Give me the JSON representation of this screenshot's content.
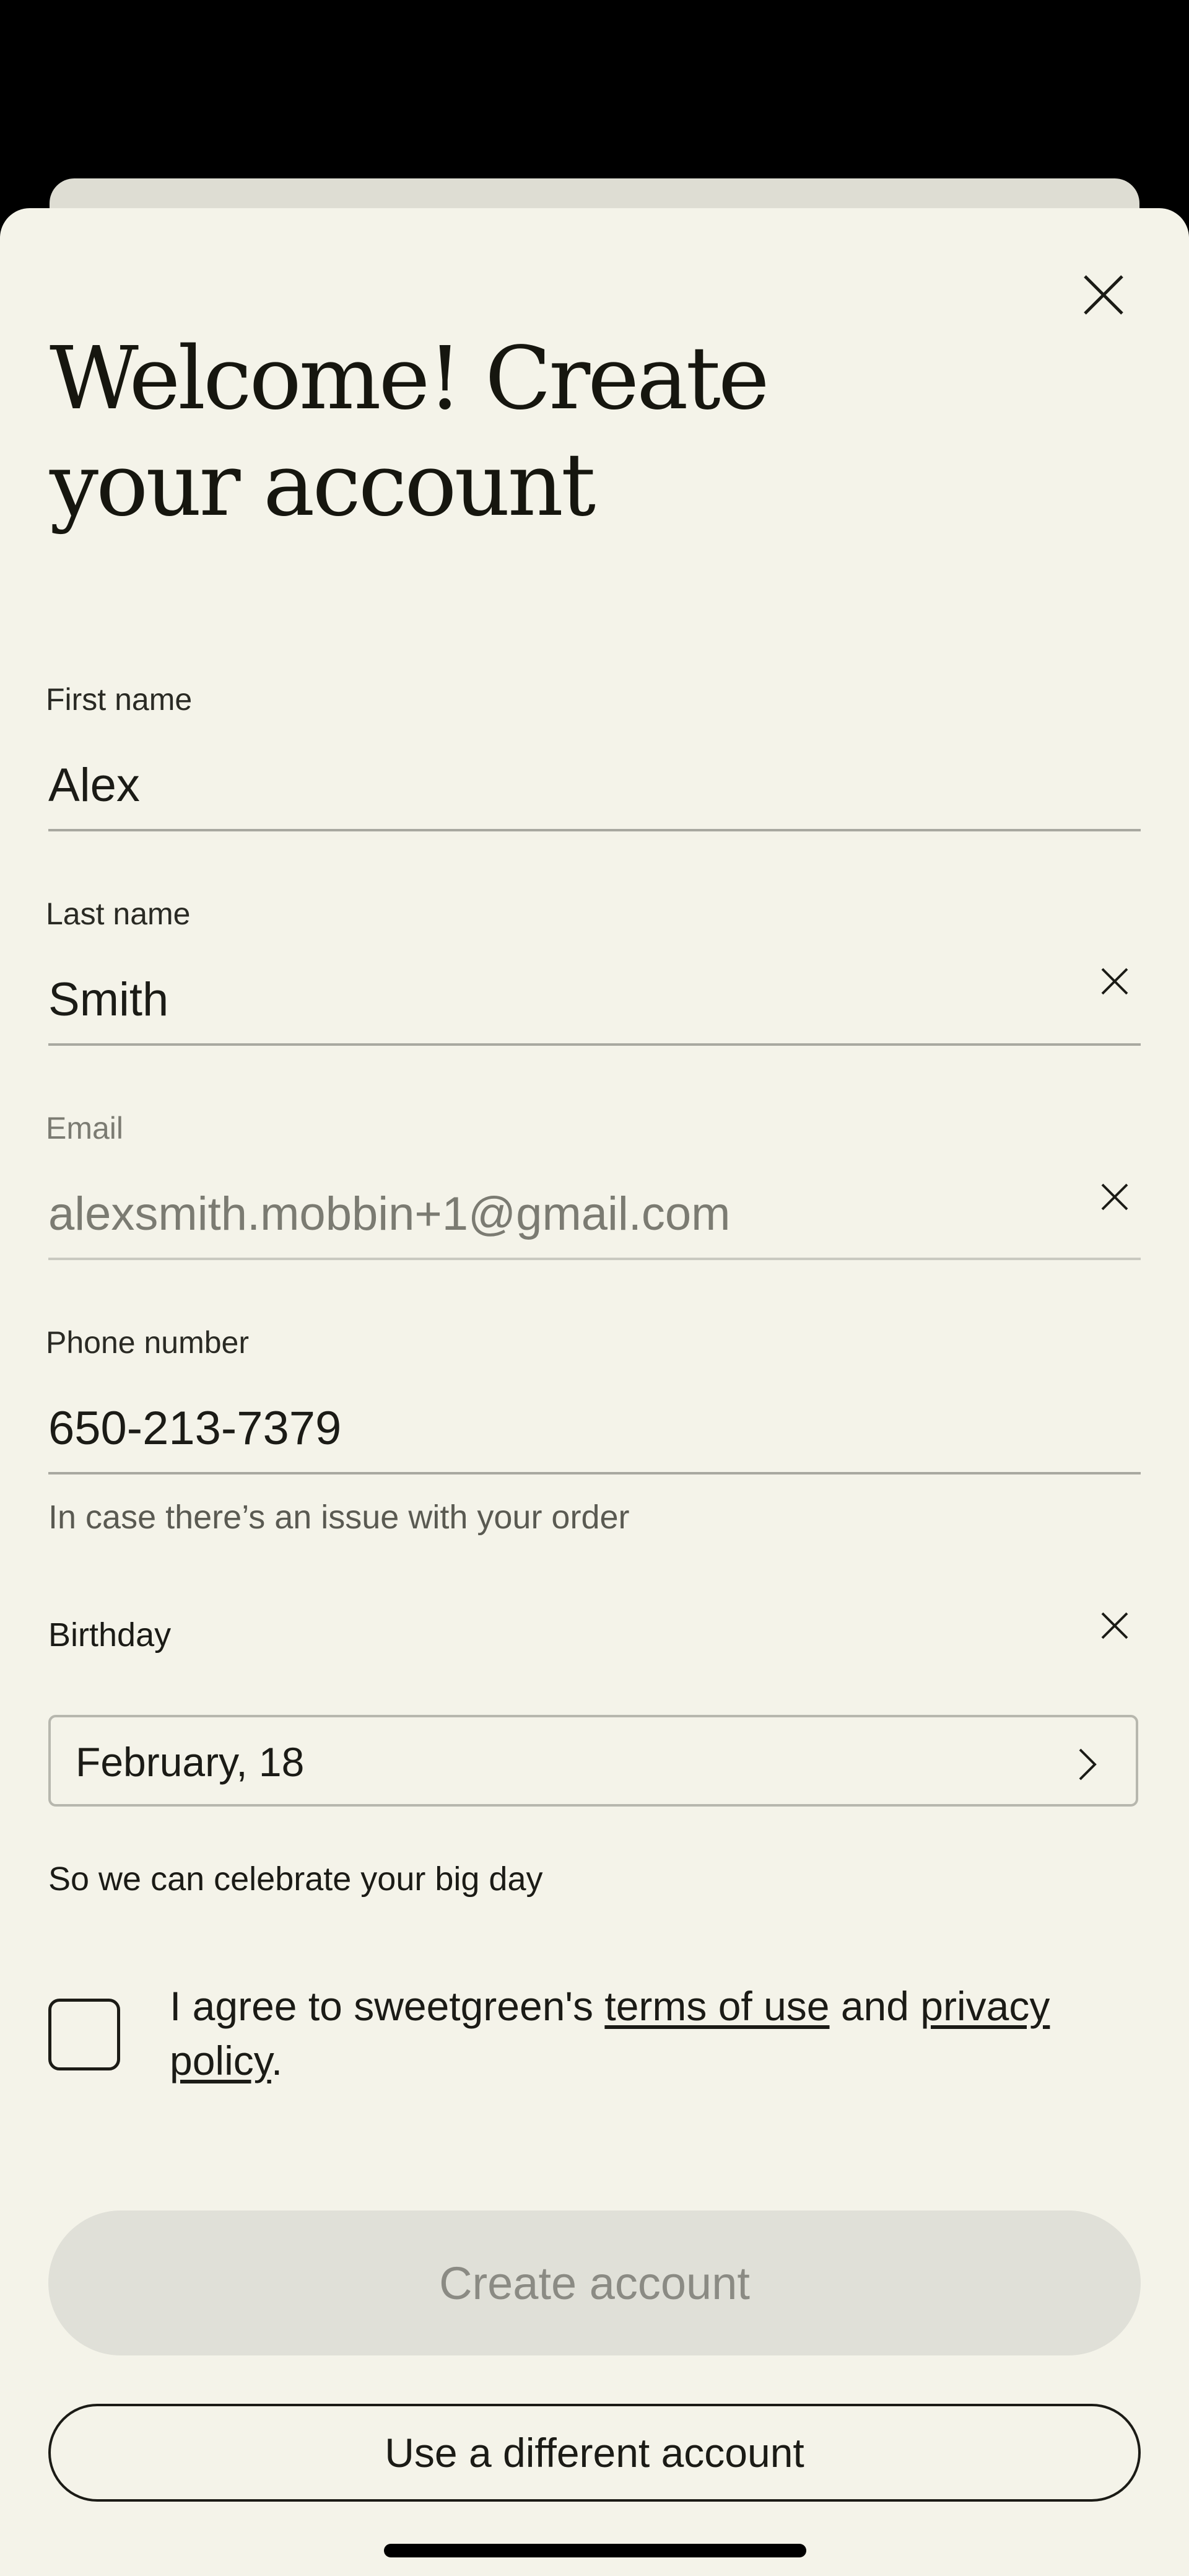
{
  "title": "Welcome! Create your account",
  "fields": {
    "first_name": {
      "label": "First name",
      "value": "Alex"
    },
    "last_name": {
      "label": "Last name",
      "value": "Smith"
    },
    "email": {
      "label": "Email",
      "value": "alexsmith.mobbin+1@gmail.com"
    },
    "phone": {
      "label": "Phone number",
      "value": "650-213-7379",
      "helper": "In case there’s an issue with your order"
    }
  },
  "birthday": {
    "label": "Birthday",
    "value": "February, 18",
    "helper": "So we can celebrate your big day"
  },
  "agreement": {
    "prefix": "I agree to sweetgreen's ",
    "terms_link": "terms of use",
    "middle": " and ",
    "privacy_link": "privacy policy",
    "suffix": ".",
    "checked": false
  },
  "buttons": {
    "create": "Create account",
    "different_account": "Use a different account"
  },
  "icons": {
    "close": "close-icon",
    "clear": "clear-icon",
    "chevron": "chevron-right-icon"
  },
  "colors": {
    "background": "#f4f3e9",
    "text": "#1b1b16",
    "disabled_button": "#e0e0d8"
  }
}
